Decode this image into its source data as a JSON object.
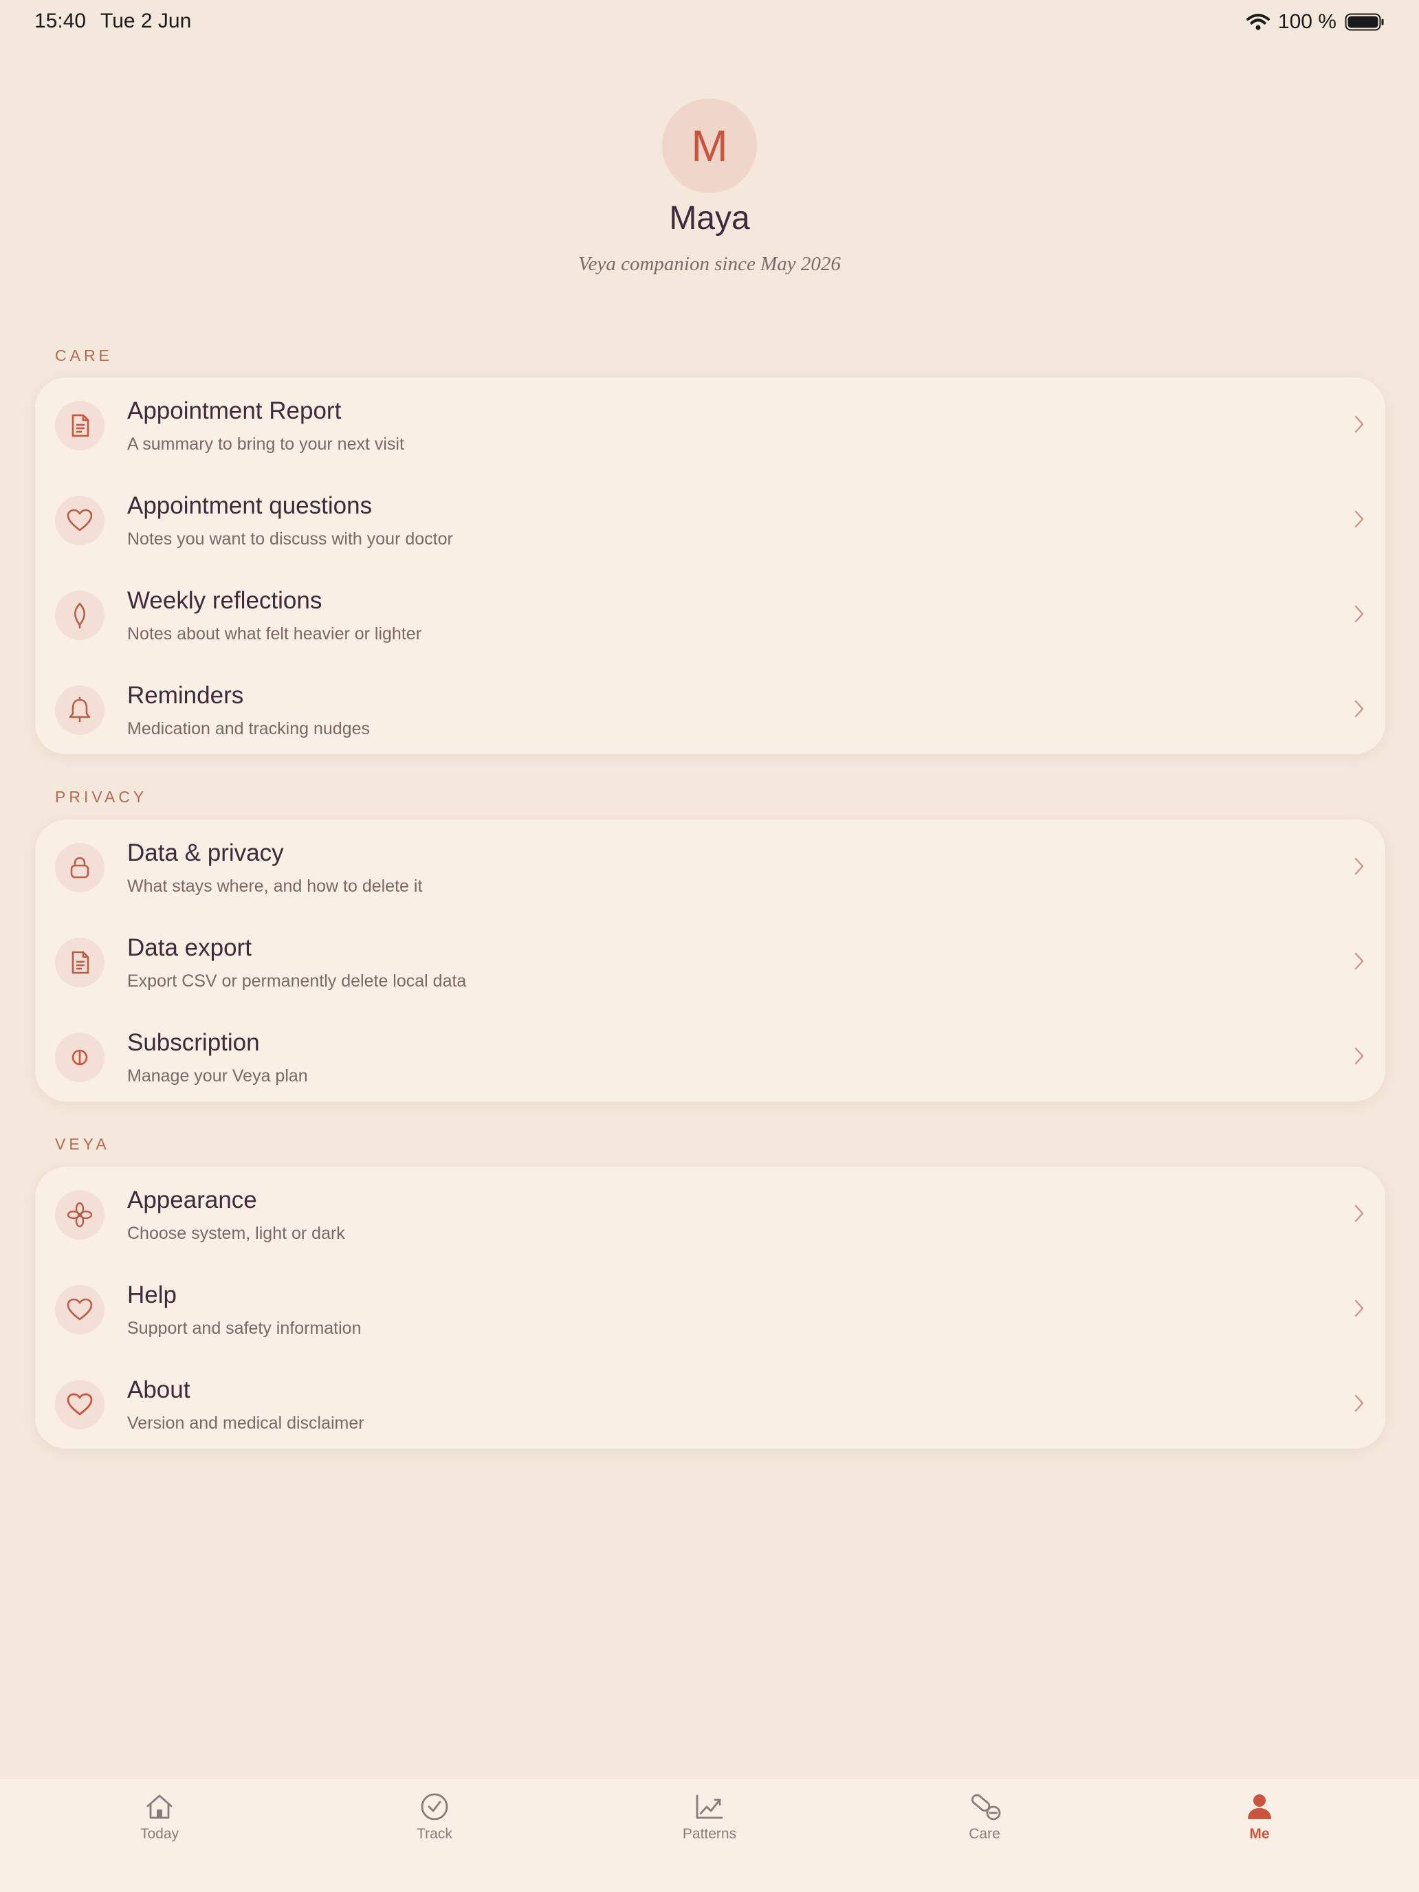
{
  "status_bar": {
    "time": "15:40",
    "date": "Tue 2 Jun",
    "battery": "100 %"
  },
  "profile": {
    "initial": "M",
    "name": "Maya",
    "since": "Veya companion since May 2026"
  },
  "sections": [
    {
      "label": "CARE",
      "items": [
        {
          "title": "Appointment Report",
          "subtitle": "A summary to bring to your next visit",
          "icon": "document-icon"
        },
        {
          "title": "Appointment questions",
          "subtitle": "Notes you want to discuss with your doctor",
          "icon": "heart-icon"
        },
        {
          "title": "Weekly reflections",
          "subtitle": "Notes about what felt heavier or lighter",
          "icon": "leaf-icon"
        },
        {
          "title": "Reminders",
          "subtitle": "Medication and tracking nudges",
          "icon": "bell-icon"
        }
      ]
    },
    {
      "label": "PRIVACY",
      "items": [
        {
          "title": "Data & privacy",
          "subtitle": "What stays where, and how to delete it",
          "icon": "lock-icon"
        },
        {
          "title": "Data export",
          "subtitle": "Export CSV or permanently delete local data",
          "icon": "document-icon"
        },
        {
          "title": "Subscription",
          "subtitle": "Manage your Veya plan",
          "icon": "pill-icon"
        }
      ]
    },
    {
      "label": "VEYA",
      "items": [
        {
          "title": "Appearance",
          "subtitle": "Choose system, light or dark",
          "icon": "flower-icon"
        },
        {
          "title": "Help",
          "subtitle": "Support and safety information",
          "icon": "heart-icon"
        },
        {
          "title": "About",
          "subtitle": "Version and medical disclaimer",
          "icon": "heart-icon"
        }
      ]
    }
  ],
  "tabs": [
    {
      "label": "Today",
      "icon": "home-icon"
    },
    {
      "label": "Track",
      "icon": "check-circle-icon"
    },
    {
      "label": "Patterns",
      "icon": "chart-icon"
    },
    {
      "label": "Care",
      "icon": "pills-icon"
    },
    {
      "label": "Me",
      "icon": "person-icon",
      "active": true
    }
  ],
  "colors": {
    "background": "#F4E8DC",
    "card": "#F9EFE4",
    "accent": "#C8553D",
    "text": "#3E2A3A"
  }
}
